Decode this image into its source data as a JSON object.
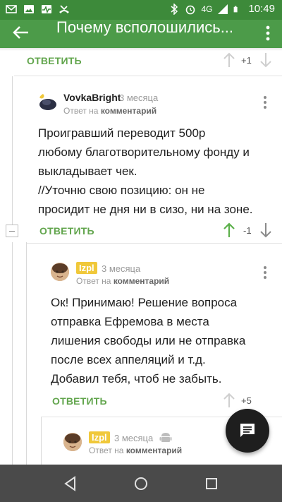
{
  "status_bar": {
    "network": "4G",
    "time": "10:49",
    "icons": [
      "gmail-icon",
      "photo-icon",
      "pulse-icon",
      "missed-call-icon",
      "bluetooth-icon",
      "alarm-icon",
      "signal-icon",
      "battery-icon"
    ]
  },
  "toolbar": {
    "title": "Почему всполошились...",
    "icons": [
      "back-arrow-icon",
      "more-vert-icon"
    ]
  },
  "colors": {
    "statusbar": "#3d8a3a",
    "toolbar": "#4c9b49",
    "accent_green": "#62a54d",
    "badge_yellow": "#f0c83a",
    "navbar": "#4a4a4a",
    "fab": "#1e1e1e"
  },
  "comments": {
    "prev": {
      "reply_label": "ОТВЕТИТЬ",
      "score": "+1"
    },
    "c1": {
      "author": "VovkaBright",
      "time": "3 месяца",
      "reply_prefix": "Ответ на",
      "reply_target": "комментарий",
      "lines": [
        "Проигравший переводит 500р",
        "любому благотворительному фонду и",
        "выкладывает чек.",
        "//Уточню свою позицию: он не",
        "просидит не дня ни в сизо, ни на зоне."
      ],
      "reply_label": "ОТВЕТИТЬ",
      "score": "-1"
    },
    "c2": {
      "author": "Izpl",
      "time": "3 месяца",
      "reply_prefix": "Ответ на",
      "reply_target": "комментарий",
      "lines": [
        "Ок! Принимаю! Решение вопроса",
        "отправка Ефремова в места",
        "лишения свободы или не отправка",
        "после всех аппеляций и т.д.",
        "Добавил тебя, чтоб не забыть."
      ],
      "reply_label": "ОТВЕТИТЬ",
      "score": "+5"
    },
    "c3": {
      "author": "Izpl",
      "time": "3 месяца",
      "reply_prefix": "Ответ на",
      "reply_target": "комментарий"
    }
  },
  "fab": {
    "icon": "comment-icon"
  },
  "nav_bar": {
    "icons": [
      "nav-back-icon",
      "nav-home-icon",
      "nav-recents-icon"
    ]
  }
}
